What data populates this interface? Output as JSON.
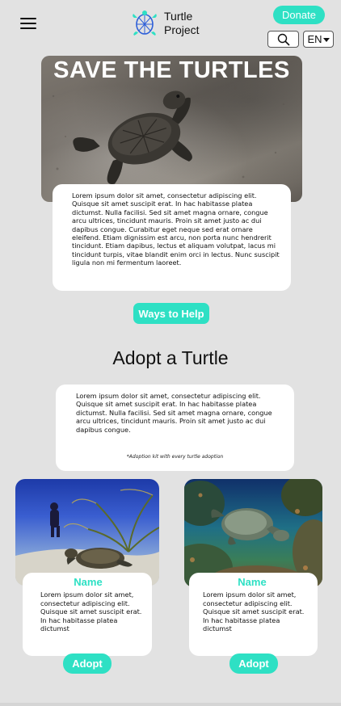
{
  "header": {
    "brand_line1": "Turtle",
    "brand_line2": "Project",
    "donate_label": "Donate",
    "language": "EN",
    "icons": [
      "menu-icon",
      "turtle-logo-icon",
      "search-icon",
      "chevron-down-icon"
    ]
  },
  "hero": {
    "title": "SAVE THE TURTLES",
    "body": "Lorem ipsum dolor sit amet, consectetur adipiscing elit. Quisque sit amet suscipit erat. In hac habitasse platea dictumst. Nulla facilisi. Sed sit amet magna ornare, congue arcu ultrices, tincidunt mauris. Proin sit amet justo ac dui dapibus congue. Curabitur eget neque sed erat ornare eleifend. Etiam dignissim est arcu, non porta nunc hendrerit tincidunt. Etiam dapibus, lectus et aliquam volutpat, lacus mi tincidunt turpis, vitae blandit enim orci in lectus. Nunc suscipit ligula non mi fermentum laoreet."
  },
  "ways_to_help_label": "Ways to Help",
  "adopt": {
    "title": "Adopt a Turtle",
    "body": "Lorem ipsum dolor sit amet, consectetur adipiscing elit. Quisque sit amet suscipit erat. In hac habitasse platea dictumst. Nulla facilisi. Sed sit amet magna ornare, congue arcu ultrices, tincidunt mauris. Proin sit amet justo ac dui dapibus congue.",
    "note": "*Adoption kit with every turtle adoption"
  },
  "turtles": [
    {
      "name": "Name",
      "description": "Lorem ipsum dolor sit amet, consectetur adipiscing elit. Quisque sit amet suscipit erat. In hac habitasse platea dictumst",
      "button_label": "Adopt"
    },
    {
      "name": "Name",
      "description": "Lorem ipsum dolor sit amet, consectetur adipiscing elit. Quisque sit amet suscipit erat. In hac habitasse platea dictumst",
      "button_label": "Adopt"
    }
  ],
  "colors": {
    "accent": "#2ee0c4",
    "background": "#e2e2e2",
    "card": "#ffffff"
  }
}
